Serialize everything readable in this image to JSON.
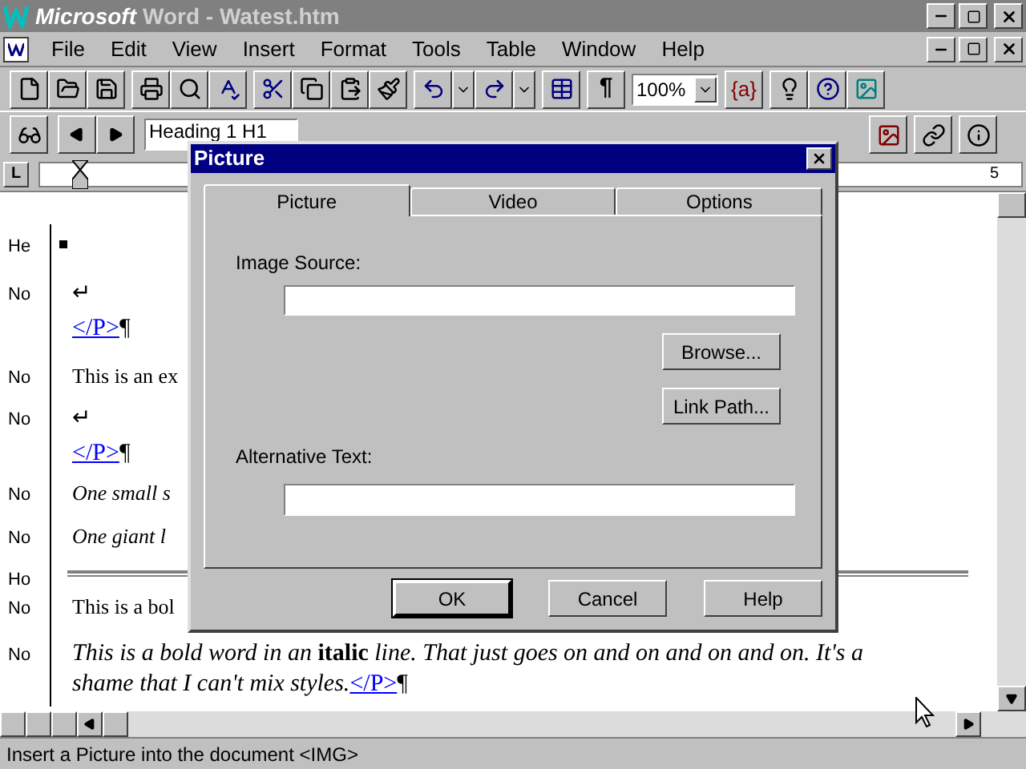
{
  "window": {
    "app": "Microsoft",
    "title": "Word - Watest.htm"
  },
  "menu": [
    {
      "label": "File"
    },
    {
      "label": "Edit"
    },
    {
      "label": "View"
    },
    {
      "label": "Insert"
    },
    {
      "label": "Format"
    },
    {
      "label": "Tools"
    },
    {
      "label": "Table"
    },
    {
      "label": "Window"
    },
    {
      "label": "Help"
    }
  ],
  "toolbar": {
    "pilcrow": "¶",
    "zoom": "100%",
    "field": "{a}"
  },
  "format_bar": {
    "style": "Heading 1 H1"
  },
  "ruler": {
    "tab": "L",
    "number": "5"
  },
  "document": {
    "rows": [
      {
        "style": "He",
        "kind": "bullet"
      },
      {
        "style": "No",
        "kind": "break",
        "symbol": "↵",
        "link": "</P>",
        "mark": "¶"
      },
      {
        "style": "No",
        "kind": "text",
        "text": "This is an ex"
      },
      {
        "style": "No",
        "kind": "break",
        "symbol": "↵",
        "link": "</P>",
        "mark": "¶"
      },
      {
        "style": "No",
        "kind": "italic",
        "text": "One small s"
      },
      {
        "style": "No",
        "kind": "italic",
        "text": "One giant l"
      },
      {
        "style": "Ho",
        "kind": "rule"
      },
      {
        "style": "No",
        "kind": "text",
        "text": "This is a bol"
      },
      {
        "style": "No",
        "kind": "paragraph",
        "text": "This is a bold word in an **italic** line. That just goes on and on and on and on. It's a shame that I can't mix styles.",
        "link": "</P>",
        "mark": "¶"
      }
    ]
  },
  "dialog": {
    "title": "Picture",
    "tabs": [
      {
        "label": "Picture",
        "selected": true
      },
      {
        "label": "Video",
        "selected": false
      },
      {
        "label": "Options",
        "selected": false
      }
    ],
    "image_source": {
      "label": "Image Source:"
    },
    "browse": "Browse...",
    "link_path": "Link Path...",
    "alt_text": {
      "label": "Alternative Text:"
    },
    "buttons": [
      {
        "label": "OK",
        "default": true
      },
      {
        "label": "Cancel",
        "default": false
      },
      {
        "label": "Help",
        "default": false
      }
    ]
  },
  "status_bar": "Insert a Picture into the document <IMG>"
}
